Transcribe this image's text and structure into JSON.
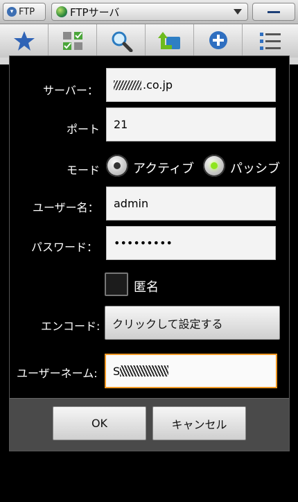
{
  "topbar": {
    "app_label": "FTP",
    "server_selector": "FTPサーバ"
  },
  "toolbar": {
    "tools": [
      "star-icon",
      "grid-check-icon",
      "search-icon",
      "folder-up-icon",
      "add-icon",
      "list-icon"
    ]
  },
  "dialog": {
    "server_label": "サーバー：",
    "server_value": ".co.jp",
    "port_label": "ポート",
    "port_value": "21",
    "mode_label": "モード",
    "mode_active": "アクティブ",
    "mode_passive": "パッシブ",
    "selected_mode": "passive",
    "username_label": "ユーザー名：",
    "username_value": "admin",
    "password_label": "パスワード：",
    "password_value": "•••••••••",
    "anonymous_label": "匿名",
    "anonymous_checked": false,
    "encoding_label": "エンコード:",
    "encoding_button": "クリックして設定する",
    "username2_label": "ユーザーネーム:",
    "username2_prefix": "S"
  },
  "footer": {
    "ok_label": "OK",
    "cancel_label": "キャンセル"
  },
  "colors": {
    "focus_border": "#f29a25",
    "radio_selected": "#8ee51f"
  }
}
